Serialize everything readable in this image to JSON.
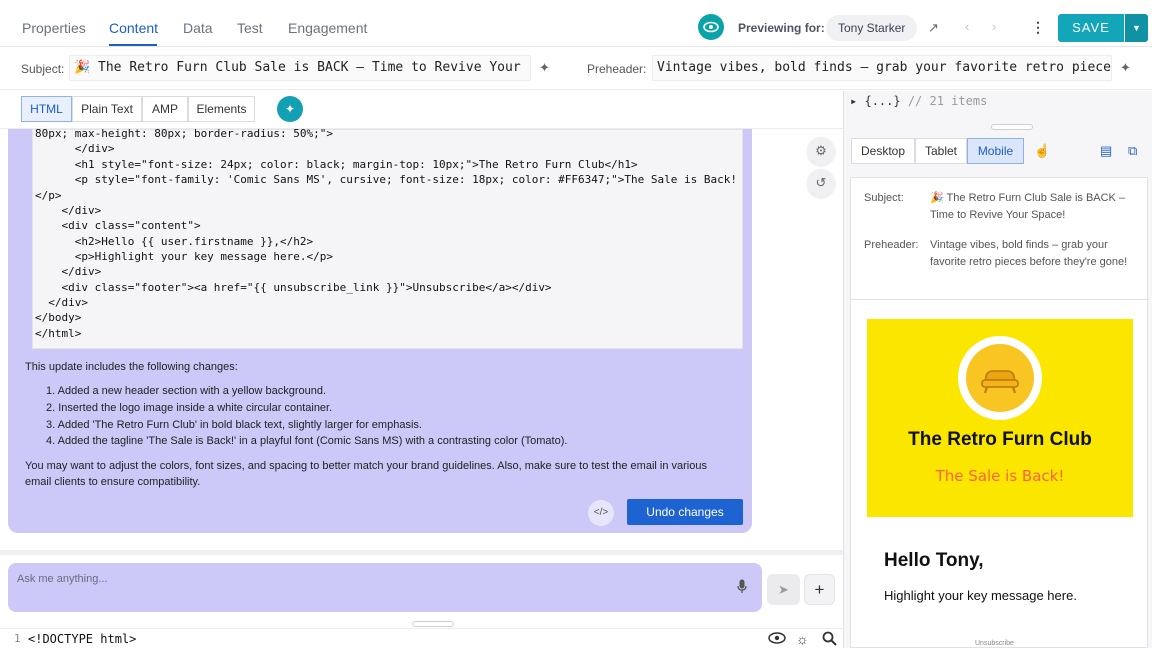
{
  "tabs": [
    "Properties",
    "Content",
    "Data",
    "Test",
    "Engagement"
  ],
  "preview": {
    "label": "Previewing for:",
    "user": "Tony Starker"
  },
  "toolbar": {
    "save_label": "SAVE"
  },
  "subject": {
    "label": "Subject:",
    "value": "🎉 The Retro Furn Club Sale is BACK – Time to Revive Your"
  },
  "preheader": {
    "label": "Preheader:",
    "value": "Vintage vibes, bold finds – grab your favorite retro pieces"
  },
  "editor_modes": [
    "HTML",
    "Plain Text",
    "AMP",
    "Elements"
  ],
  "code_lines": [
    "80px; max-height: 80px; border-radius: 50%;\">",
    "      </div>",
    "      <h1 style=\"font-size: 24px; color: black; margin-top: 10px;\">The Retro Furn Club</h1>",
    "      <p style=\"font-family: 'Comic Sans MS', cursive; font-size: 18px; color: #FF6347;\">The Sale is Back!",
    "</p>",
    "    </div>",
    "    <div class=\"content\">",
    "      <h2>Hello {{ user.firstname }},</h2>",
    "      <p>Highlight your key message here.</p>",
    "    </div>",
    "    <div class=\"footer\"><a href=\"{{ unsubscribe_link }}\">Unsubscribe</a></div>",
    "  </div>",
    "</body>",
    "</html>"
  ],
  "reply": {
    "intro": "This update includes the following changes:",
    "changes": [
      "1. Added a new header section with a yellow background.",
      "2. Inserted the logo image inside a white circular container.",
      "3. Added 'The Retro Furn Club' in bold black text, slightly larger for emphasis.",
      "4. Added the tagline 'The Sale is Back!' in a playful font (Comic Sans MS) with a contrasting color (Tomato)."
    ],
    "note_line1": "You may want to adjust the colors, font sizes, and spacing to better match your brand guidelines. Also, make sure to test the email in various",
    "note_line2": "email clients to ensure compatibility.",
    "code_toggle": "</>",
    "undo_label": "Undo changes"
  },
  "ask": {
    "placeholder": "Ask me anything..."
  },
  "bottom_code": {
    "line_number": "1",
    "text": "<!DOCTYPE html>"
  },
  "json_preview": {
    "text": "{...}",
    "comment": "// 21 items"
  },
  "device_tabs": [
    "Desktop",
    "Tablet",
    "Mobile"
  ],
  "preview_card": {
    "subject_label": "Subject:",
    "subject_text": "🎉 The Retro Furn Club Sale is BACK – Time to Revive Your Space!",
    "preheader_label": "Preheader:",
    "preheader_text": "Vintage vibes, bold finds – grab your favorite retro pieces before they're gone!"
  },
  "email": {
    "title": "The Retro Furn Club",
    "tagline": "The Sale is Back!",
    "greeting": "Hello Tony,",
    "message": "Highlight your key message here.",
    "footer": "Unsubscribe"
  },
  "colors": {
    "accent": "#1d5ec8",
    "teal": "#12a6b8",
    "chat": "#ccc8f8",
    "hero": "#fbe600",
    "tagline": "#ff6347"
  }
}
